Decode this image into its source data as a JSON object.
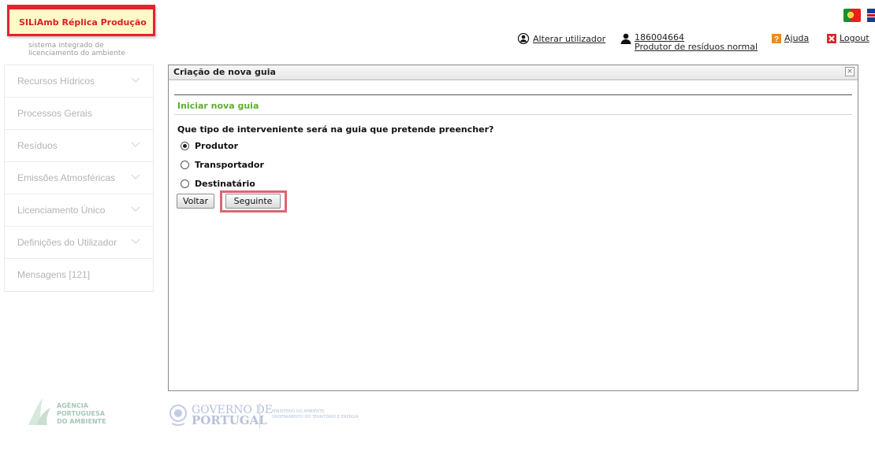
{
  "brand": {
    "title": "SILiAmb Réplica Produção",
    "subtitle_line1": "sistema integrado de",
    "subtitle_line2": "licenciamento do ambiente"
  },
  "header": {
    "change_user": "Alterar utilizador",
    "user_id": "186004664",
    "user_role": "Produtor de resíduos normal",
    "help": "Ajuda",
    "logout": "Logout"
  },
  "sidebar": {
    "items": [
      {
        "label": "Recursos Hídricos",
        "chevron": true
      },
      {
        "label": "Processos Gerais",
        "chevron": false
      },
      {
        "label": "Resíduos",
        "chevron": true
      },
      {
        "label": "Emissões Atmosféricas",
        "chevron": true
      },
      {
        "label": "Licenciamento Único",
        "chevron": true
      },
      {
        "label": "Definições do Utilizador",
        "chevron": true
      },
      {
        "label": "Mensagens [121]",
        "chevron": false
      }
    ]
  },
  "panel": {
    "title": "Criação de nova guia",
    "close_glyph": "×",
    "section_title": "Iniciar nova guia",
    "question": "Que tipo de interveniente será na guia que pretende preencher?",
    "options": [
      {
        "label": "Produtor",
        "checked": true
      },
      {
        "label": "Transportador",
        "checked": false
      },
      {
        "label": "Destinatário",
        "checked": false
      }
    ],
    "back_button": "Voltar",
    "next_button": "Seguinte"
  },
  "footer": {
    "apa_line1": "AGÊNCIA",
    "apa_line2": "PORTUGUESA",
    "apa_line3": "DO AMBIENTE",
    "gov_line1": "GOVERNO DE",
    "gov_line2": "PORTUGAL",
    "ministry_line1": "MINISTÉRIO DO AMBIENTE,",
    "ministry_line2": "ORDENAMENTO DO TERRITÓRIO E ENERGIA"
  },
  "colors": {
    "brand_red": "#e8212f",
    "brand_bg": "#fff9c6",
    "section_green": "#5fae2e",
    "highlight": "#e06372",
    "help_icon": "#f08a1c",
    "logout_icon": "#d82828"
  },
  "icons": {
    "change_user": "user-switch-icon",
    "user": "person-icon",
    "help": "question-mark-icon",
    "logout": "close-x-icon",
    "flag_pt": "portugal-flag-icon",
    "flag_uk": "uk-flag-icon"
  }
}
